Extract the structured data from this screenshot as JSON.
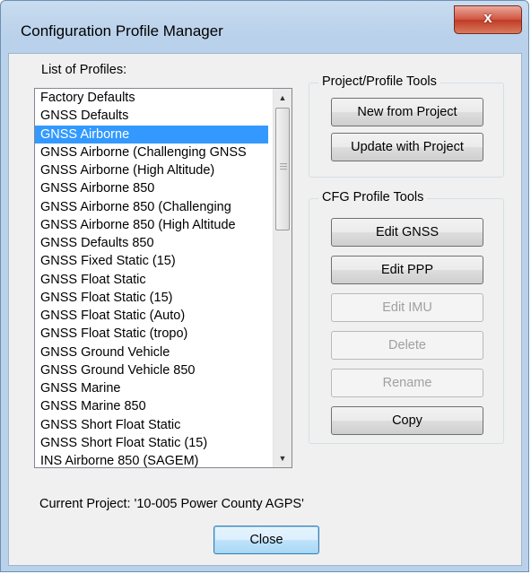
{
  "window": {
    "title": "Configuration Profile Manager",
    "close_glyph": "x"
  },
  "profiles": {
    "label": "List of Profiles:",
    "items": [
      "Factory Defaults",
      "GNSS Defaults",
      "GNSS Airborne",
      "GNSS Airborne (Challenging GNSS",
      "GNSS Airborne (High Altitude)",
      "GNSS Airborne 850",
      "GNSS Airborne 850 (Challenging",
      "GNSS Airborne 850 (High Altitude",
      "GNSS Defaults 850",
      "GNSS Fixed Static (15)",
      "GNSS Float Static",
      "GNSS Float Static (15)",
      "GNSS Float Static (Auto)",
      "GNSS Float Static (tropo)",
      "GNSS Ground Vehicle",
      "GNSS Ground Vehicle 850",
      "GNSS Marine",
      "GNSS Marine 850",
      "GNSS Short Float Static",
      "GNSS Short Float Static (15)",
      "INS Airborne 850 (SAGEM)"
    ],
    "selected": "GNSS Airborne"
  },
  "project_tools": {
    "title": "Project/Profile Tools",
    "new_from_project": "New from Project",
    "update_with_project": "Update with Project"
  },
  "cfg_tools": {
    "title": "CFG Profile Tools",
    "edit_gnss": "Edit GNSS",
    "edit_ppp": "Edit PPP",
    "edit_imu": "Edit IMU",
    "delete": "Delete",
    "rename": "Rename",
    "copy": "Copy"
  },
  "footer": {
    "current_project": "Current Project: '10-005 Power County AGPS'",
    "close": "Close"
  },
  "colors": {
    "selection": "#3399ff",
    "window_frame": "#b9d1ea",
    "close_button": "#c03b26"
  }
}
